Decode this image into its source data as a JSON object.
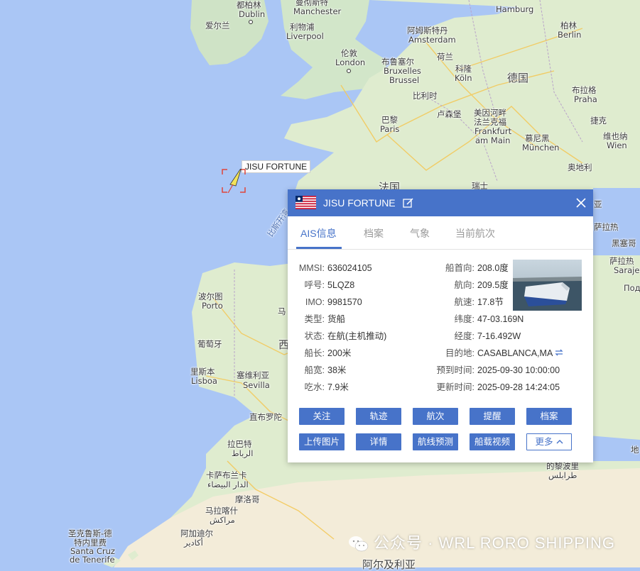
{
  "map": {
    "labels": {
      "dublin_cn": "都柏林",
      "dublin": "Dublin",
      "ireland": "爱尔兰",
      "manchester_cn": "曼彻斯特",
      "manchester": "Manchester",
      "liverpool_cn": "利物浦",
      "liverpool": "Liverpool",
      "london_cn": "伦敦",
      "london": "London",
      "hamburg": "Hamburg",
      "berlin_cn": "柏林",
      "berlin": "Berlin",
      "amsterdam_cn": "阿姆斯特丹",
      "amsterdam": "Amsterdam",
      "netherlands": "荷兰",
      "brussels_cn": "布鲁塞尔",
      "brussels_fr": "Bruxelles",
      "brussels_nl": "Brussel",
      "cologne_cn": "科隆",
      "cologne": "Köln",
      "belgium": "比利时",
      "germany": "德国",
      "prague_cn": "布拉格",
      "prague": "Praha",
      "luxembourg": "卢森堡",
      "frankfurt_cn1": "美因河畔",
      "frankfurt_cn2": "法兰克福",
      "frankfurt1": "Frankfurt",
      "frankfurt2": "am Main",
      "paris_cn": "巴黎",
      "paris": "Paris",
      "czech": "捷克",
      "munich_cn": "慕尼黑",
      "munich": "München",
      "vienna_cn": "维也纳",
      "vienna": "Wien",
      "austria": "奥地利",
      "france": "法国",
      "switzerland": "瑞士",
      "biscay": "比斯开湾",
      "porto_cn": "波尔图",
      "porto": "Porto",
      "portugal": "葡萄牙",
      "lisbon_cn": "里斯本",
      "lisbon": "Lisboa",
      "madrid_cn": "马",
      "spain": "西",
      "seville_cn": "塞维利亚",
      "seville": "Sevilla",
      "gibraltar": "直布罗陀",
      "rabat_cn": "拉巴特",
      "rabat_ar": "الرباط",
      "casablanca_cn": "卡萨布兰卡",
      "casablanca_ar": "الدار البيضاء",
      "morocco": "摩洛哥",
      "marrakech_cn": "马拉喀什",
      "marrakech_ar": "مراكش",
      "agadir_cn": "阿加迪尔",
      "agadir_ar": "أكادير",
      "tenerife_cn1": "圣克鲁斯-德",
      "tenerife_cn2": "特内里费",
      "tenerife1": "Santa Cruz",
      "tenerife2": "de Tenerife",
      "tripoli_cn": "的黎波里",
      "tripoli_ar": "طرابلس",
      "algeria": "阿尔及利亚",
      "sarajevo_cn": "萨拉热",
      "sarajevo": "Sarajev",
      "montenegro": "黑塞哥",
      "italy": "亚",
      "podgorica": "Подго",
      "sea_edge": "地"
    }
  },
  "ship_marker": {
    "label": "JISU FORTUNE"
  },
  "panel": {
    "ship_name": "JISU FORTUNE",
    "flag": "liberia-flag",
    "tabs": [
      "AIS信息",
      "档案",
      "气象",
      "当前航次"
    ],
    "active_tab": 0,
    "left": [
      {
        "label": "MMSI:",
        "value": "636024105"
      },
      {
        "label": "呼号:",
        "value": "5LQZ8"
      },
      {
        "label": "IMO:",
        "value": "9981570"
      },
      {
        "label": "类型:",
        "value": "货船"
      },
      {
        "label": "状态:",
        "value": "在航(主机推动)"
      },
      {
        "label": "船长:",
        "value": "200米"
      },
      {
        "label": "船宽:",
        "value": "38米"
      },
      {
        "label": "吃水:",
        "value": "7.9米"
      }
    ],
    "right": [
      {
        "label": "船首向:",
        "value": "208.0度"
      },
      {
        "label": "航向:",
        "value": "209.5度"
      },
      {
        "label": "航速:",
        "value": "17.8节"
      },
      {
        "label": "纬度:",
        "value": "47-03.169N"
      },
      {
        "label": "经度:",
        "value": "7-16.492W"
      },
      {
        "label": "目的地:",
        "value": "CASABLANCA,MA"
      },
      {
        "label": "预到时间:",
        "value": "2025-09-30 10:00:00"
      },
      {
        "label": "更新时间:",
        "value": "2025-09-28 14:24:05"
      }
    ],
    "buttons_row1": [
      "关注",
      "轨迹",
      "航次",
      "提醒",
      "档案"
    ],
    "buttons_row2": [
      "上传图片",
      "详情",
      "航线预测",
      "船载视频",
      "更多"
    ],
    "accent": "#4773c9"
  },
  "watermark": "公众号 · WRL RORO SHIPPING"
}
